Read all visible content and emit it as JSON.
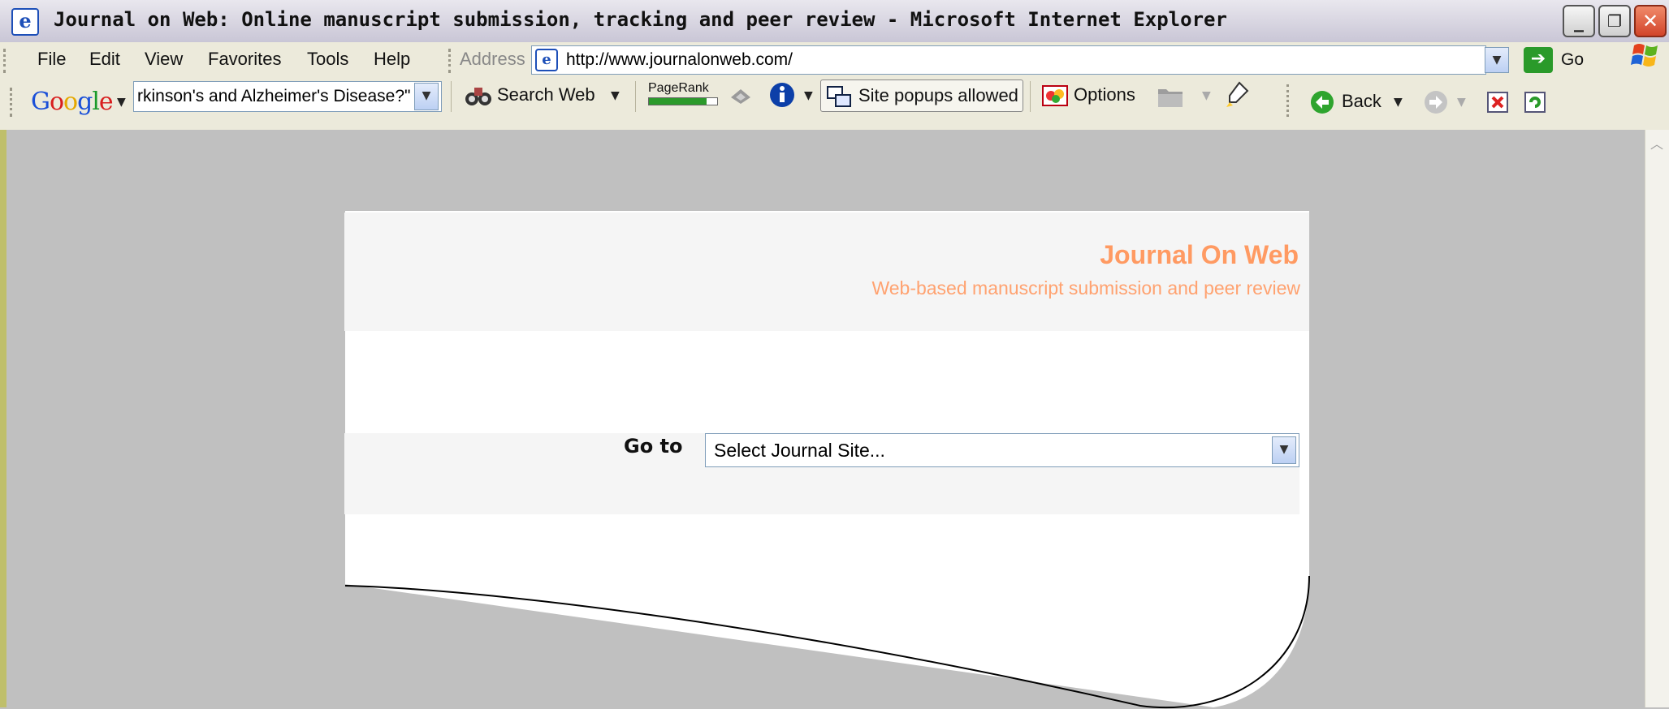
{
  "window": {
    "title": "Journal on Web: Online manuscript submission, tracking and peer review - Microsoft Internet Explorer",
    "controls": [
      "_",
      "❐",
      "✕"
    ]
  },
  "menu": {
    "items": [
      "File",
      "Edit",
      "View",
      "Favorites",
      "Tools",
      "Help"
    ]
  },
  "address": {
    "label": "Address",
    "url": "http://www.journalonweb.com/",
    "go_label": "Go"
  },
  "google_toolbar": {
    "search_text": "rkinson's and Alzheimer's Disease?\"",
    "search_web_label": "Search Web",
    "pagerank_label": "PageRank",
    "pagerank_level": 0.85,
    "popups_label": "Site popups allowed",
    "options_label": "Options",
    "back_label": "Back"
  },
  "site": {
    "title": "Journal On Web",
    "subtitle": "Web-based manuscript submission and peer review",
    "goto_label": "Go to",
    "select_value": "Select Journal Site..."
  },
  "colors": {
    "accent": "#ff9a62",
    "page_bg": "#c0c0c0"
  }
}
